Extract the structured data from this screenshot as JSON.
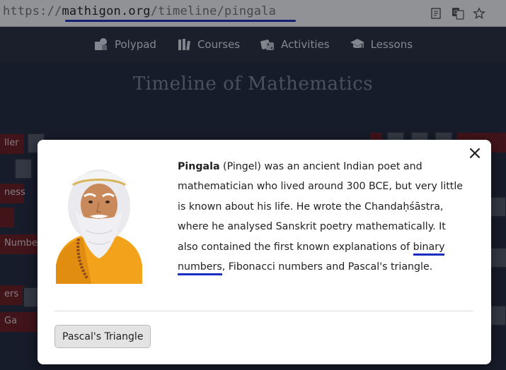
{
  "browser": {
    "url_prefix": "https://",
    "url_host": "mathigon.org",
    "url_path": "/timeline/pingala",
    "icons": [
      "reader-mode-icon",
      "translate-icon",
      "bookmark-star-icon"
    ]
  },
  "nav": {
    "items": [
      {
        "label": "Polypad",
        "icon": "polypad-icon"
      },
      {
        "label": "Courses",
        "icon": "courses-icon"
      },
      {
        "label": "Activities",
        "icon": "activities-icon"
      },
      {
        "label": "Lessons",
        "icon": "lessons-icon"
      }
    ]
  },
  "page": {
    "title": "Timeline of Mathematics",
    "background_rows": [
      "ller",
      "ness",
      "Numbers",
      "ers",
      "Ga"
    ]
  },
  "modal": {
    "name": "Pingala",
    "bio_1": " (Pingel) was an ancient Indian poet and mathematician who lived around 300 BCE, but very little is known about his life. He wrote the Chandaḥśāstra, where he analysed Sanskrit poetry mathematically. It also contained the first known explanations of ",
    "bio_link": "binary numbers",
    "bio_2": ", Fibonacci numbers and Pascal's triangle.",
    "close_symbol": "×",
    "button_label": "Pascal's Triangle"
  },
  "colors": {
    "accent_underline": "#1a2fbf",
    "nav_bg": "#282e3c",
    "timeline_red": "#6e1b1e",
    "robe": "#f2a21b"
  }
}
